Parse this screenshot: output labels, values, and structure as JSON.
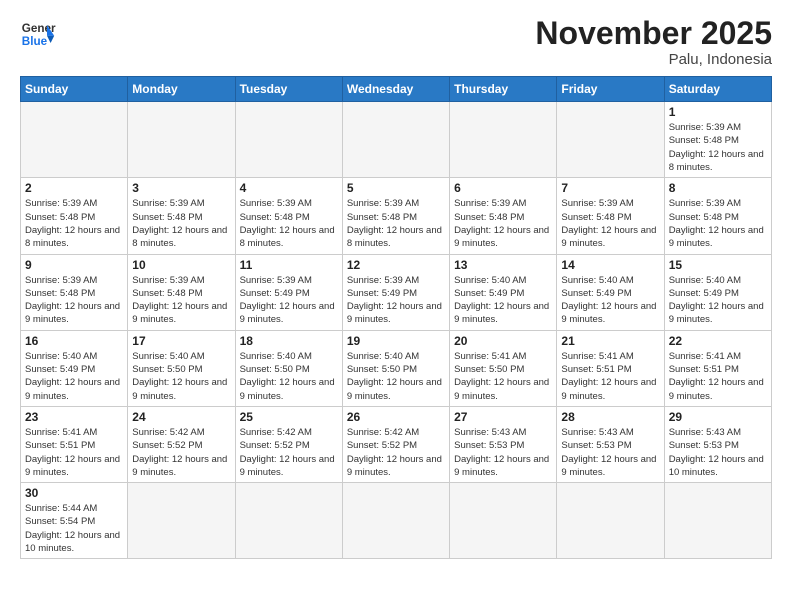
{
  "logo": {
    "text_general": "General",
    "text_blue": "Blue"
  },
  "header": {
    "month_title": "November 2025",
    "location": "Palu, Indonesia"
  },
  "weekdays": [
    "Sunday",
    "Monday",
    "Tuesday",
    "Wednesday",
    "Thursday",
    "Friday",
    "Saturday"
  ],
  "days": [
    {
      "date": "",
      "empty": true
    },
    {
      "date": "",
      "empty": true
    },
    {
      "date": "",
      "empty": true
    },
    {
      "date": "",
      "empty": true
    },
    {
      "date": "",
      "empty": true
    },
    {
      "date": "",
      "empty": true
    },
    {
      "date": "1",
      "info": "Sunrise: 5:39 AM\nSunset: 5:48 PM\nDaylight: 12 hours and 8 minutes."
    },
    {
      "date": "2",
      "info": "Sunrise: 5:39 AM\nSunset: 5:48 PM\nDaylight: 12 hours and 8 minutes."
    },
    {
      "date": "3",
      "info": "Sunrise: 5:39 AM\nSunset: 5:48 PM\nDaylight: 12 hours and 8 minutes."
    },
    {
      "date": "4",
      "info": "Sunrise: 5:39 AM\nSunset: 5:48 PM\nDaylight: 12 hours and 8 minutes."
    },
    {
      "date": "5",
      "info": "Sunrise: 5:39 AM\nSunset: 5:48 PM\nDaylight: 12 hours and 8 minutes."
    },
    {
      "date": "6",
      "info": "Sunrise: 5:39 AM\nSunset: 5:48 PM\nDaylight: 12 hours and 9 minutes."
    },
    {
      "date": "7",
      "info": "Sunrise: 5:39 AM\nSunset: 5:48 PM\nDaylight: 12 hours and 9 minutes."
    },
    {
      "date": "8",
      "info": "Sunrise: 5:39 AM\nSunset: 5:48 PM\nDaylight: 12 hours and 9 minutes."
    },
    {
      "date": "9",
      "info": "Sunrise: 5:39 AM\nSunset: 5:48 PM\nDaylight: 12 hours and 9 minutes."
    },
    {
      "date": "10",
      "info": "Sunrise: 5:39 AM\nSunset: 5:48 PM\nDaylight: 12 hours and 9 minutes."
    },
    {
      "date": "11",
      "info": "Sunrise: 5:39 AM\nSunset: 5:49 PM\nDaylight: 12 hours and 9 minutes."
    },
    {
      "date": "12",
      "info": "Sunrise: 5:39 AM\nSunset: 5:49 PM\nDaylight: 12 hours and 9 minutes."
    },
    {
      "date": "13",
      "info": "Sunrise: 5:40 AM\nSunset: 5:49 PM\nDaylight: 12 hours and 9 minutes."
    },
    {
      "date": "14",
      "info": "Sunrise: 5:40 AM\nSunset: 5:49 PM\nDaylight: 12 hours and 9 minutes."
    },
    {
      "date": "15",
      "info": "Sunrise: 5:40 AM\nSunset: 5:49 PM\nDaylight: 12 hours and 9 minutes."
    },
    {
      "date": "16",
      "info": "Sunrise: 5:40 AM\nSunset: 5:49 PM\nDaylight: 12 hours and 9 minutes."
    },
    {
      "date": "17",
      "info": "Sunrise: 5:40 AM\nSunset: 5:50 PM\nDaylight: 12 hours and 9 minutes."
    },
    {
      "date": "18",
      "info": "Sunrise: 5:40 AM\nSunset: 5:50 PM\nDaylight: 12 hours and 9 minutes."
    },
    {
      "date": "19",
      "info": "Sunrise: 5:40 AM\nSunset: 5:50 PM\nDaylight: 12 hours and 9 minutes."
    },
    {
      "date": "20",
      "info": "Sunrise: 5:41 AM\nSunset: 5:50 PM\nDaylight: 12 hours and 9 minutes."
    },
    {
      "date": "21",
      "info": "Sunrise: 5:41 AM\nSunset: 5:51 PM\nDaylight: 12 hours and 9 minutes."
    },
    {
      "date": "22",
      "info": "Sunrise: 5:41 AM\nSunset: 5:51 PM\nDaylight: 12 hours and 9 minutes."
    },
    {
      "date": "23",
      "info": "Sunrise: 5:41 AM\nSunset: 5:51 PM\nDaylight: 12 hours and 9 minutes."
    },
    {
      "date": "24",
      "info": "Sunrise: 5:42 AM\nSunset: 5:52 PM\nDaylight: 12 hours and 9 minutes."
    },
    {
      "date": "25",
      "info": "Sunrise: 5:42 AM\nSunset: 5:52 PM\nDaylight: 12 hours and 9 minutes."
    },
    {
      "date": "26",
      "info": "Sunrise: 5:42 AM\nSunset: 5:52 PM\nDaylight: 12 hours and 9 minutes."
    },
    {
      "date": "27",
      "info": "Sunrise: 5:43 AM\nSunset: 5:53 PM\nDaylight: 12 hours and 9 minutes."
    },
    {
      "date": "28",
      "info": "Sunrise: 5:43 AM\nSunset: 5:53 PM\nDaylight: 12 hours and 9 minutes."
    },
    {
      "date": "29",
      "info": "Sunrise: 5:43 AM\nSunset: 5:53 PM\nDaylight: 12 hours and 10 minutes."
    },
    {
      "date": "30",
      "info": "Sunrise: 5:44 AM\nSunset: 5:54 PM\nDaylight: 12 hours and 10 minutes."
    }
  ]
}
